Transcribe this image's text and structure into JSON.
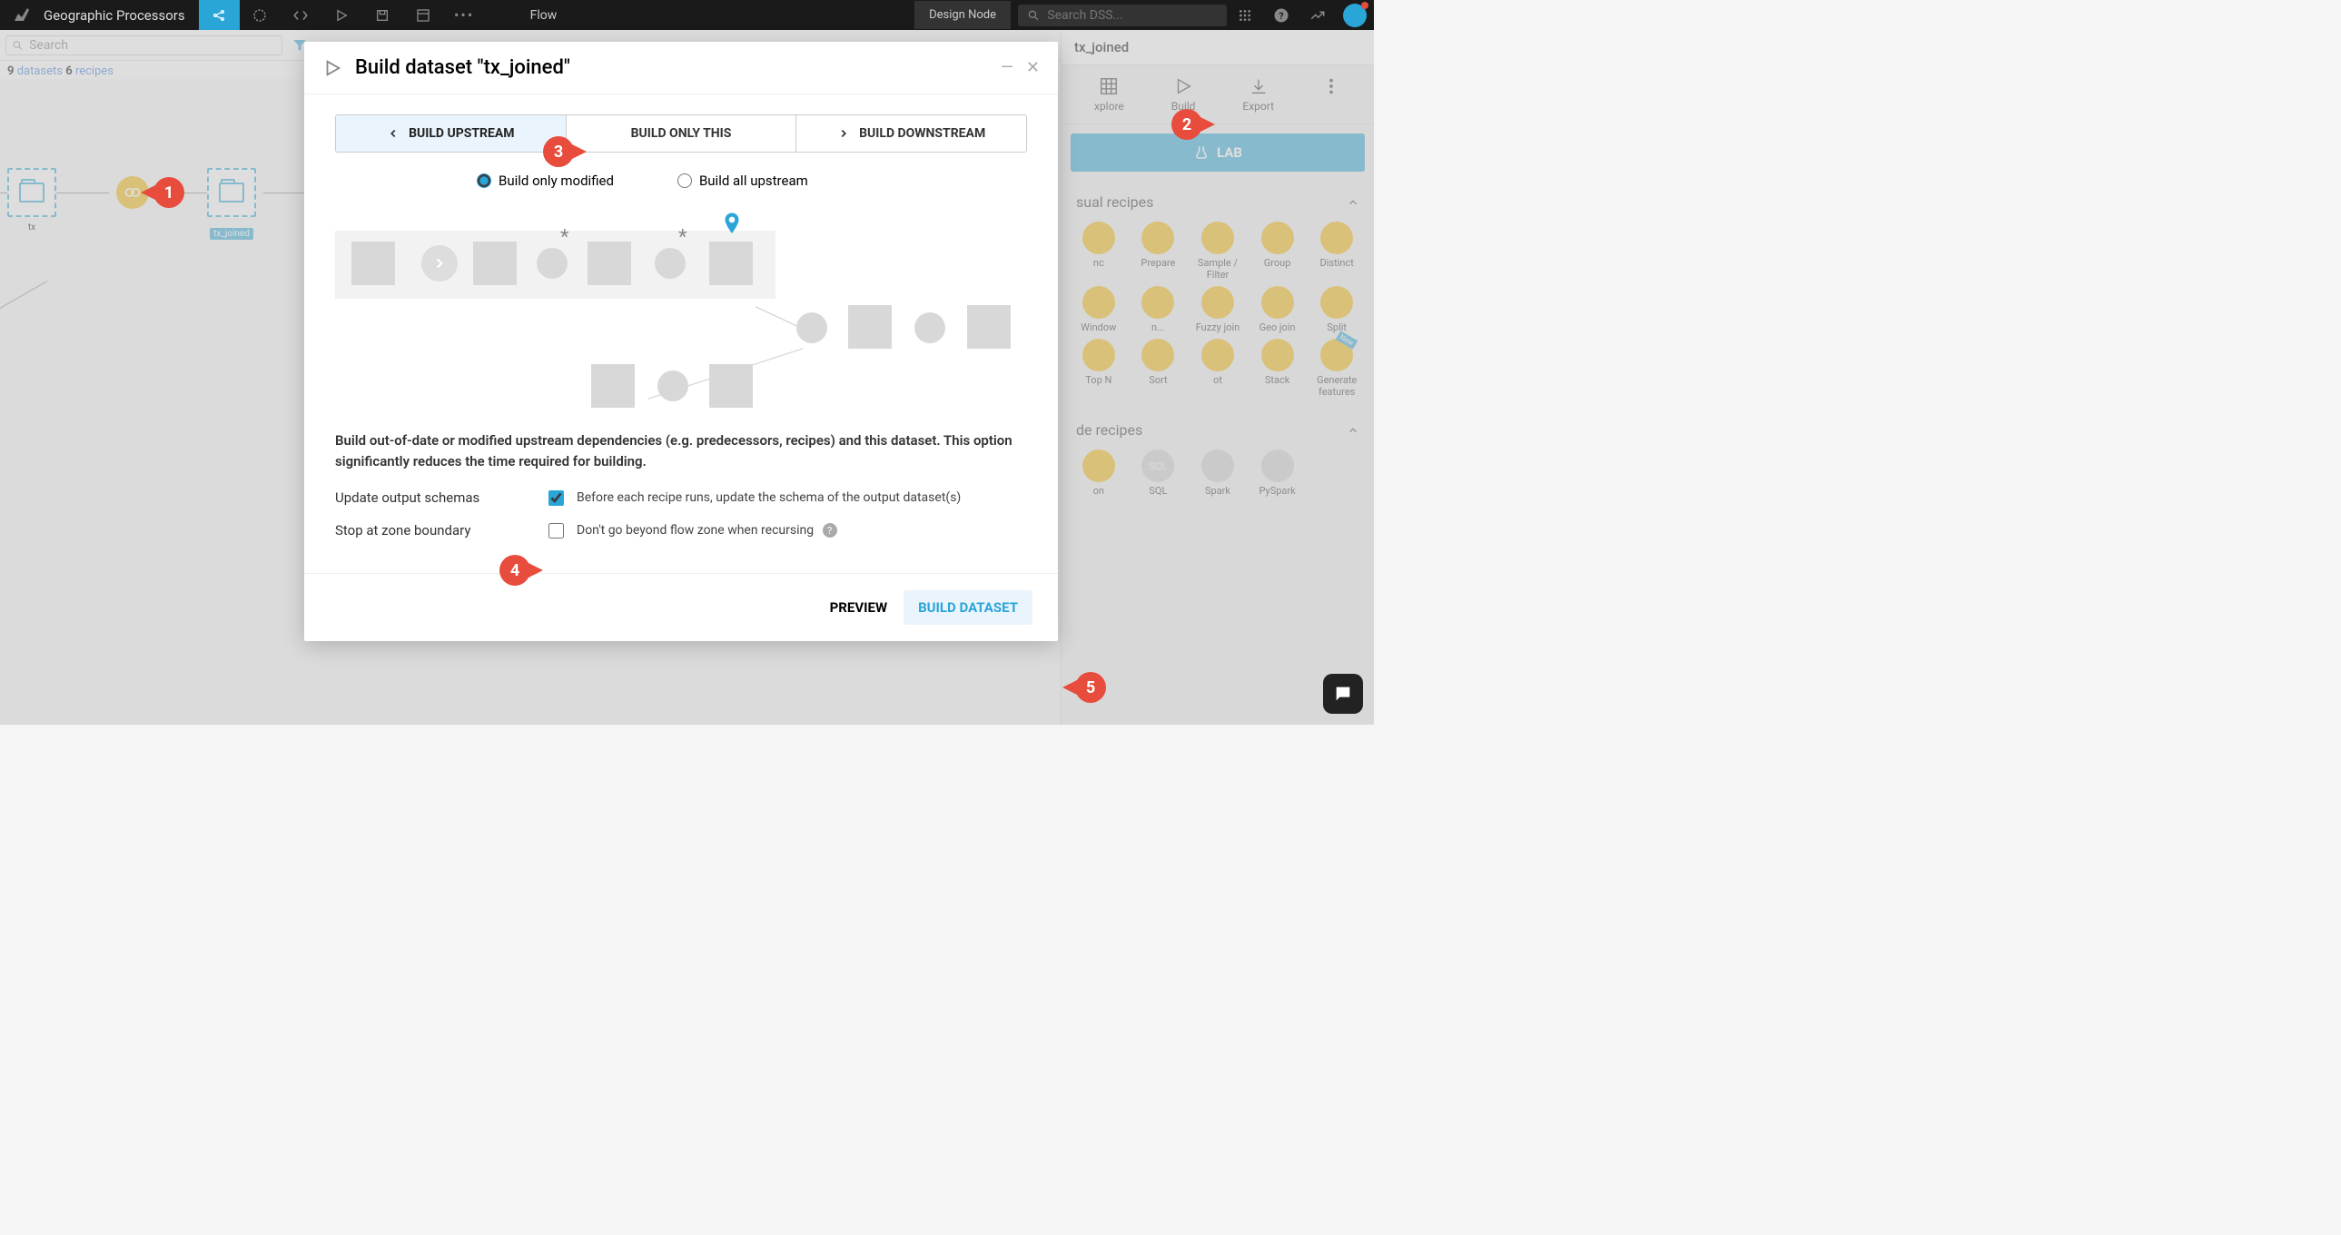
{
  "topbar": {
    "project_name": "Geographic Processors",
    "flow_label": "Flow",
    "design_node": "Design Node",
    "search_placeholder": "Search DSS..."
  },
  "subbar": {
    "search_placeholder": "Search"
  },
  "stats": {
    "datasets_count": "9",
    "datasets_label": "datasets",
    "recipes_count": "6",
    "recipes_label": "recipes"
  },
  "flow_nodes": {
    "tx": "tx",
    "tx_joined": "tx_joined"
  },
  "right_panel": {
    "title": "tx_joined",
    "actions": {
      "explore": "xplore",
      "build": "Build",
      "export": "Export"
    },
    "lab_label": "LAB",
    "visual_recipes_header": "sual recipes",
    "code_recipes_header": "de recipes",
    "visual_recipes": [
      {
        "label": "nc"
      },
      {
        "label": "Prepare"
      },
      {
        "label": "Sample / Filter"
      },
      {
        "label": "Group"
      },
      {
        "label": "Distinct"
      },
      {
        "label": "Window"
      },
      {
        "label": "n..."
      },
      {
        "label": "Fuzzy join"
      },
      {
        "label": "Geo join"
      },
      {
        "label": "Split"
      },
      {
        "label": "Top N"
      },
      {
        "label": "Sort"
      },
      {
        "label": "ot"
      },
      {
        "label": "Stack"
      },
      {
        "label": "Generate features"
      }
    ],
    "code_recipes": [
      {
        "label": "on"
      },
      {
        "label": "SQL"
      },
      {
        "label": "Spark"
      },
      {
        "label": "PySpark"
      }
    ]
  },
  "modal": {
    "title": "Build dataset \"tx_joined\"",
    "tabs": {
      "upstream": "BUILD UPSTREAM",
      "only_this": "BUILD ONLY THIS",
      "downstream": "BUILD DOWNSTREAM"
    },
    "radios": {
      "modified": "Build only modified",
      "all": "Build all upstream"
    },
    "description": "Build out-of-date or modified upstream dependencies (e.g. predecessors, recipes) and this dataset. This option significantly reduces the time required for building.",
    "options": {
      "update_schemas_label": "Update output schemas",
      "update_schemas_text": "Before each recipe runs, update the schema of the output dataset(s)",
      "stop_zone_label": "Stop at zone boundary",
      "stop_zone_text": "Don't go beyond flow zone when recursing"
    },
    "footer": {
      "preview": "PREVIEW",
      "build": "BUILD DATASET"
    }
  },
  "annotations": {
    "a1": "1",
    "a2": "2",
    "a3": "3",
    "a4": "4",
    "a5": "5"
  }
}
